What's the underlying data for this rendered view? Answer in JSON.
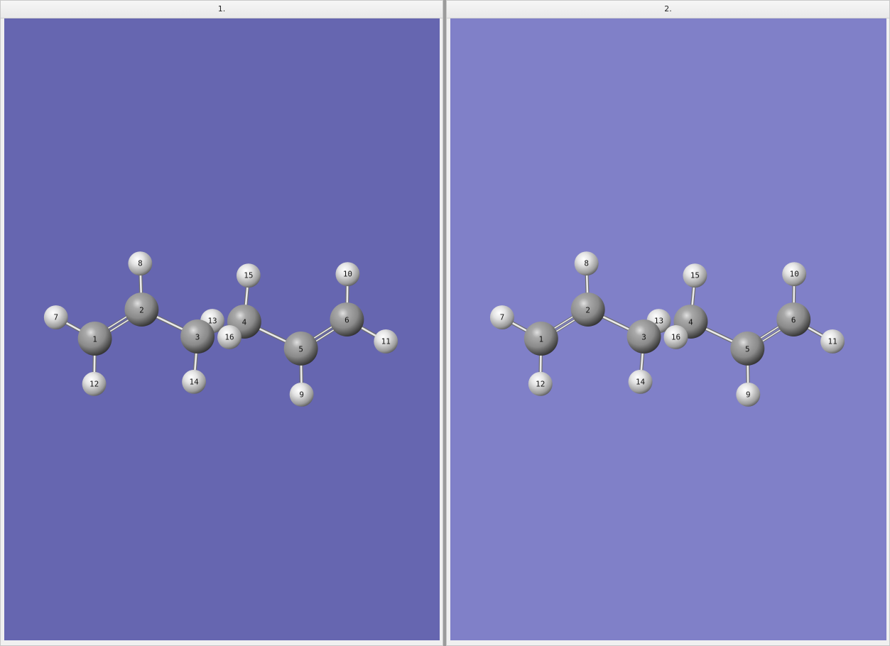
{
  "windows": [
    {
      "title": "1.",
      "background": "#6666b0"
    },
    {
      "title": "2.",
      "background": "#8080c8"
    }
  ],
  "molecule": {
    "atoms": [
      {
        "label": "1",
        "element": "C"
      },
      {
        "label": "2",
        "element": "C"
      },
      {
        "label": "3",
        "element": "C"
      },
      {
        "label": "4",
        "element": "C"
      },
      {
        "label": "5",
        "element": "C"
      },
      {
        "label": "6",
        "element": "C"
      },
      {
        "label": "7",
        "element": "H"
      },
      {
        "label": "8",
        "element": "H"
      },
      {
        "label": "9",
        "element": "H"
      },
      {
        "label": "10",
        "element": "H"
      },
      {
        "label": "11",
        "element": "H"
      },
      {
        "label": "12",
        "element": "H"
      },
      {
        "label": "13",
        "element": "H"
      },
      {
        "label": "14",
        "element": "H"
      },
      {
        "label": "15",
        "element": "H"
      },
      {
        "label": "16",
        "element": "H"
      }
    ],
    "bonds": [
      [
        1,
        2,
        2
      ],
      [
        2,
        3,
        1
      ],
      [
        3,
        4,
        1
      ],
      [
        4,
        5,
        1
      ],
      [
        5,
        6,
        2
      ],
      [
        1,
        7,
        1
      ],
      [
        1,
        12,
        1
      ],
      [
        2,
        8,
        1
      ],
      [
        3,
        13,
        1
      ],
      [
        3,
        14,
        1
      ],
      [
        4,
        15,
        1
      ],
      [
        4,
        16,
        1
      ],
      [
        5,
        9,
        1
      ],
      [
        6,
        10,
        1
      ],
      [
        6,
        11,
        1
      ]
    ],
    "element_colors": {
      "C": "#8a8a8a",
      "H": "#e4e4e4"
    }
  }
}
